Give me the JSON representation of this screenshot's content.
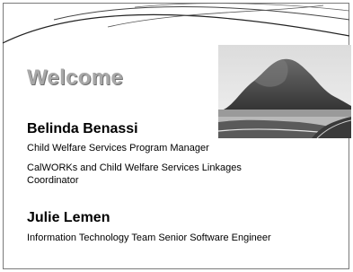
{
  "slide": {
    "heading": "Welcome",
    "people": [
      {
        "name": "Belinda Benassi",
        "title_lines": [
          "Child Welfare Services Program Manager",
          "CalWORKs and Child Welfare Services Linkages",
          "Coordinator"
        ]
      },
      {
        "name": "Julie Lemen",
        "title_lines": [
          "Information Technology Team Senior Software Engineer"
        ]
      }
    ],
    "photo": {
      "subject": "grayscale photo of a large rock formation beside a curving coastal road"
    }
  },
  "colors": {
    "heading": "#a8a8a8",
    "heading_shadow": "#6f6f6f",
    "text": "#000000",
    "frame": "#7a7a7a"
  }
}
